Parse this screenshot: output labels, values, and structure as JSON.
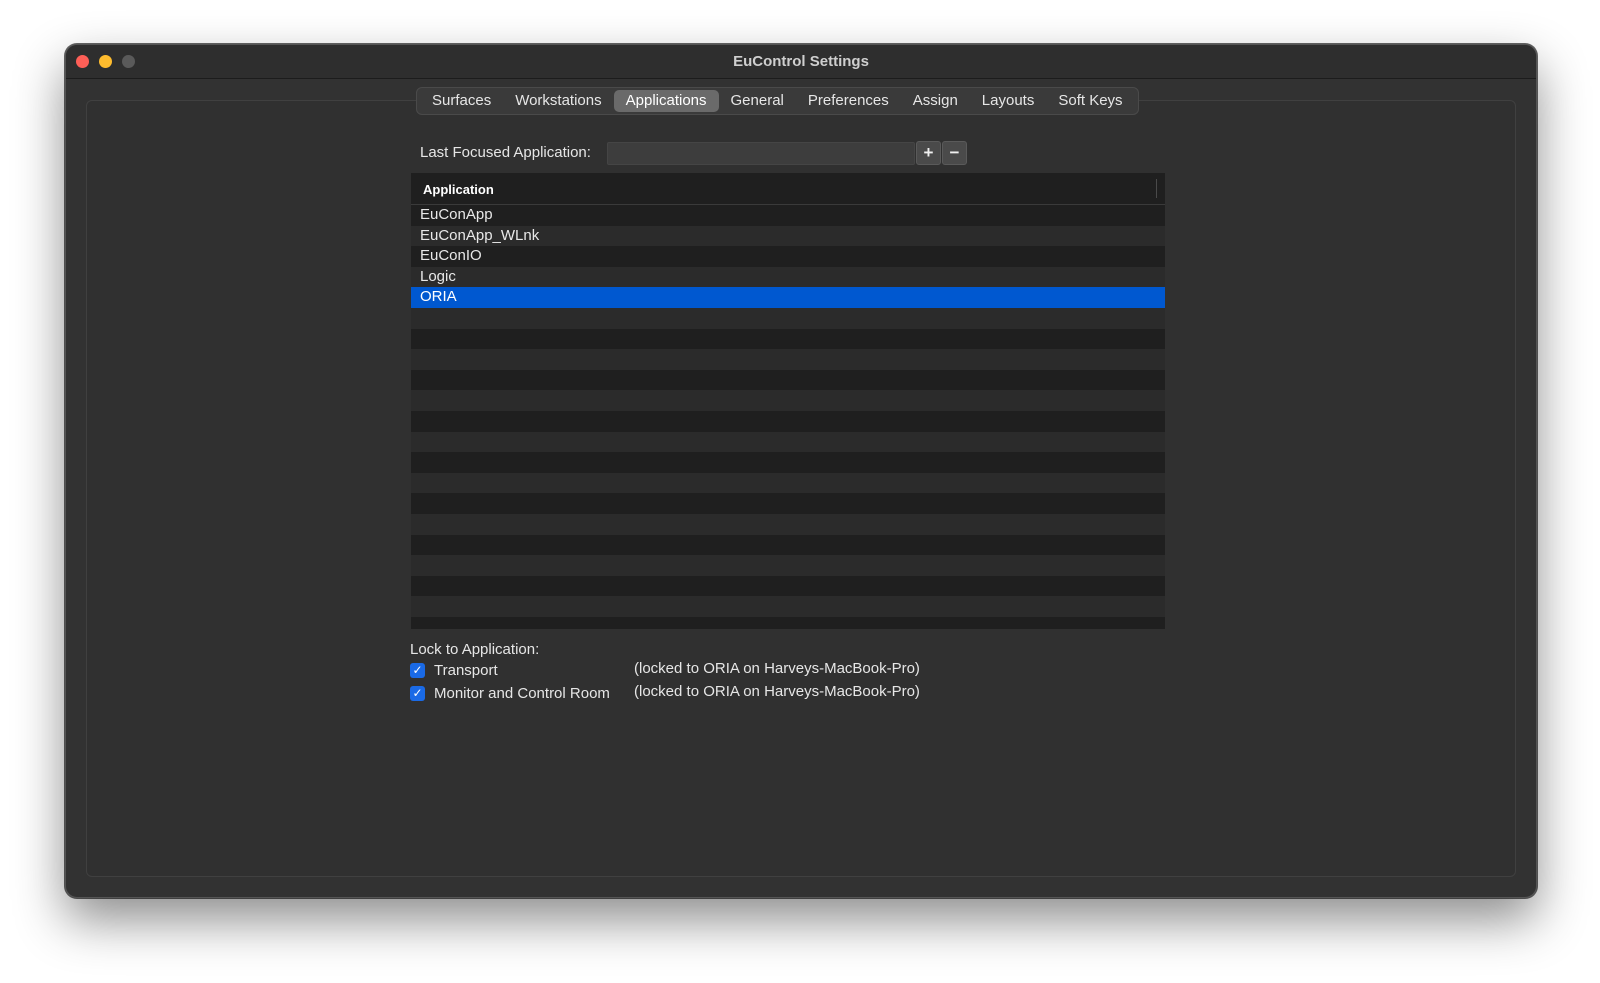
{
  "window": {
    "title": "EuControl Settings"
  },
  "tabs": [
    {
      "label": "Surfaces",
      "selected": false
    },
    {
      "label": "Workstations",
      "selected": false
    },
    {
      "label": "Applications",
      "selected": true
    },
    {
      "label": "General",
      "selected": false
    },
    {
      "label": "Preferences",
      "selected": false
    },
    {
      "label": "Assign",
      "selected": false
    },
    {
      "label": "Layouts",
      "selected": false
    },
    {
      "label": "Soft Keys",
      "selected": false
    }
  ],
  "last_focused": {
    "label": "Last Focused Application:",
    "value": "",
    "add_icon": "plus-icon",
    "add_symbol": "+",
    "remove_icon": "minus-icon",
    "remove_symbol": "−"
  },
  "table": {
    "column_header": "Application",
    "rows": [
      "EuConApp",
      "EuConApp_WLnk",
      "EuConIO",
      "Logic",
      "ORIA"
    ],
    "selected_index": 4,
    "empty_rows": 16
  },
  "lock": {
    "label": "Lock to Application:",
    "options": [
      {
        "label": "Transport",
        "checked": true,
        "check_icon": "checkmark-icon",
        "check_symbol": "✓",
        "status": "(locked to ORIA on Harveys-MacBook-Pro)"
      },
      {
        "label": "Monitor and Control Room",
        "checked": true,
        "check_icon": "checkmark-icon",
        "check_symbol": "✓",
        "status": "(locked to ORIA on Harveys-MacBook-Pro)"
      }
    ]
  },
  "colors": {
    "selection": "#0058d0",
    "checkbox": "#1a6ae6",
    "close": "#fe5f57",
    "minimize": "#febc2e"
  }
}
